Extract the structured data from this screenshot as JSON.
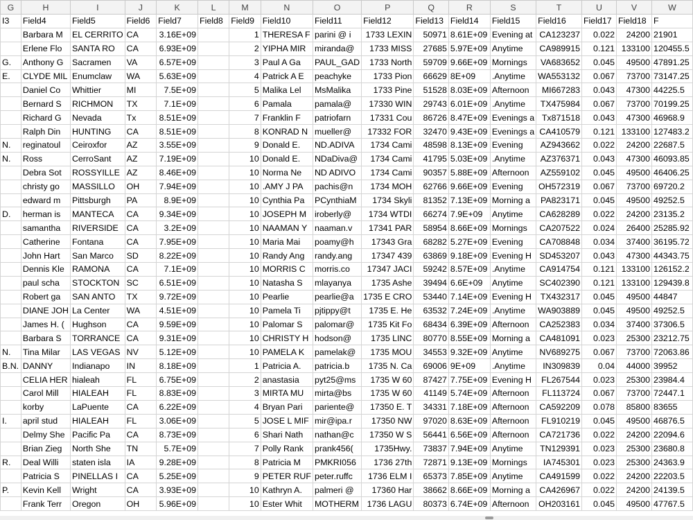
{
  "columns": [
    "G",
    "H",
    "I",
    "J",
    "K",
    "L",
    "M",
    "N",
    "O",
    "P",
    "Q",
    "R",
    "S",
    "T",
    "U",
    "V",
    "W"
  ],
  "rows": [
    [
      "I3",
      "Field4",
      "Field5",
      "Field6",
      "Field7",
      "Field8",
      "Field9",
      "Field10",
      "Field11",
      "Field12",
      "Field13",
      "Field14",
      "Field15",
      "Field16",
      "Field17",
      "Field18",
      "F"
    ],
    [
      "",
      "Barbara M",
      "EL CERRITO",
      "CA",
      "3.16E+09",
      "",
      "1",
      "THERESA F",
      "parini @ i",
      "1733 LEXIN",
      "50971",
      "8.61E+09",
      "Evening at",
      "CA123237",
      "0.022",
      "24200",
      "21901"
    ],
    [
      "",
      "Erlene Flo",
      "SANTA RO",
      "CA",
      "6.93E+09",
      "",
      "2",
      "YIPHA MIR",
      "miranda@",
      "1733 MISS",
      "27685",
      "5.97E+09",
      "Anytime",
      "CA989915",
      "0.121",
      "133100",
      "120455.5"
    ],
    [
      "G.",
      "Anthony G",
      "Sacramen",
      "VA",
      "6.57E+09",
      "",
      "3",
      "Paul A Ga",
      "PAUL_GAD",
      "1733 North",
      "59709",
      "9.66E+09",
      "Mornings",
      "VA683652",
      "0.045",
      "49500",
      "47891.25"
    ],
    [
      "E.",
      "CLYDE MIL",
      "Enumclaw",
      "WA",
      "5.63E+09",
      "",
      "4",
      "Patrick A E",
      "peachyke",
      "1733 Pion",
      "66629",
      "8E+09",
      ".Anytime",
      "WA553132",
      "0.067",
      "73700",
      "73147.25"
    ],
    [
      "",
      "Daniel Co",
      "Whittier",
      "MI",
      "7.5E+09",
      "",
      "5",
      "Malika Lel",
      "MsMalika",
      "1733 Pine",
      "51528",
      "8.03E+09",
      "Afternoon",
      "MI667283",
      "0.043",
      "47300",
      "44225.5"
    ],
    [
      "",
      "Bernard S",
      "RICHMON",
      "TX",
      "7.1E+09",
      "",
      "6",
      "Pamala",
      "pamala@",
      "17330 WIN",
      "29743",
      "6.01E+09",
      ".Anytime",
      "TX475984",
      "0.067",
      "73700",
      "70199.25"
    ],
    [
      "",
      "Richard G",
      "Nevada",
      "Tx",
      "8.51E+09",
      "",
      "7",
      "Franklin F",
      "patriofarn",
      "17331 Cou",
      "86726",
      "8.47E+09",
      "Evenings a",
      "Tx871518",
      "0.043",
      "47300",
      "46968.9"
    ],
    [
      "",
      "Ralph Din",
      "HUNTING",
      "CA",
      "8.51E+09",
      "",
      "8",
      "KONRAD N",
      "mueller@",
      "17332 FOR",
      "32470",
      "9.43E+09",
      "Evenings a",
      "CA410579",
      "0.121",
      "133100",
      "127483.2"
    ],
    [
      "N.",
      "reginatoul",
      "Ceiroxfor",
      "AZ",
      "3.55E+09",
      "",
      "9",
      "Donald E.",
      "ND.ADIVA",
      "1734 Cami",
      "48598",
      "8.13E+09",
      "Evening",
      "AZ943662",
      "0.022",
      "24200",
      "22687.5"
    ],
    [
      "N.",
      "Ross",
      "CerroSant",
      "AZ",
      "7.19E+09",
      "",
      "10",
      "Donald E.",
      "NDaDiva@",
      "1734 Cami",
      "41795",
      "5.03E+09",
      ".Anytime",
      "AZ376371",
      "0.043",
      "47300",
      "46093.85"
    ],
    [
      "",
      "Debra Sot",
      "ROSSYILLE",
      "AZ",
      "8.46E+09",
      "",
      "10",
      "Norma Ne",
      "ND ADIVO",
      "1734 Cami",
      "90357",
      "5.88E+09",
      "Afternoon",
      "AZ559102",
      "0.045",
      "49500",
      "46406.25"
    ],
    [
      "",
      "christy go",
      "MASSILLO",
      "OH",
      "7.94E+09",
      "",
      "10",
      ".AMY J PA",
      "pachis@n",
      "1734 MOH",
      "62766",
      "9.66E+09",
      "Evening",
      "OH572319",
      "0.067",
      "73700",
      "69720.2"
    ],
    [
      "",
      "edward m",
      "Pittsburgh",
      "PA",
      "8.9E+09",
      "",
      "10",
      "Cynthia Pa",
      "PCynthiaM",
      "1734 Skyli",
      "81352",
      "7.13E+09",
      "Morning a",
      "PA823171",
      "0.045",
      "49500",
      "49252.5"
    ],
    [
      "D.",
      "herman is",
      "MANTECA",
      "CA",
      "9.34E+09",
      "",
      "10",
      "JOSEPH M",
      "iroberly@",
      "1734 WTDI",
      "66274",
      "7.9E+09",
      "Anytime",
      "CA628289",
      "0.022",
      "24200",
      "23135.2"
    ],
    [
      "",
      "samantha",
      "RIVERSIDE",
      "CA",
      "3.2E+09",
      "",
      "10",
      "NAAMAN Y",
      "naaman.v",
      "17341 PAR",
      "58954",
      "8.66E+09",
      "Mornings",
      "CA207522",
      "0.024",
      "26400",
      "25285.92"
    ],
    [
      "",
      "Catherine",
      "Fontana",
      "CA",
      "7.95E+09",
      "",
      "10",
      "Maria Mai",
      "poamy@h",
      "17343 Gra",
      "68282",
      "5.27E+09",
      "Evening",
      "CA708848",
      "0.034",
      "37400",
      "36195.72"
    ],
    [
      "",
      "John Hart",
      "San Marco",
      "SD",
      "8.22E+09",
      "",
      "10",
      "Randy Ang",
      "randy.ang",
      "17347 439",
      "63869",
      "9.18E+09",
      "Evening H",
      "SD453207",
      "0.043",
      "47300",
      "44343.75"
    ],
    [
      "",
      "Dennis Kle",
      "RAMONA",
      "CA",
      "7.1E+09",
      "",
      "10",
      "MORRIS C",
      "morris.co",
      "17347 JACI",
      "59242",
      "8.57E+09",
      ".Anytime",
      "CA914754",
      "0.121",
      "133100",
      "126152.2"
    ],
    [
      "",
      "paul scha",
      "STOCKTON",
      "SC",
      "6.51E+09",
      "",
      "10",
      "Natasha S",
      "mlayanya",
      "1735 Ashe",
      "39494",
      "6.6E+09",
      "Anytime",
      "SC402390",
      "0.121",
      "133100",
      "129439.8"
    ],
    [
      "",
      "Robert ga",
      "SAN ANTO",
      "TX",
      "9.72E+09",
      "",
      "10",
      "Pearlie",
      "pearlie@a",
      "1735 E CRO",
      "53440",
      "7.14E+09",
      "Evening H",
      "TX432317",
      "0.045",
      "49500",
      "44847"
    ],
    [
      "",
      "DIANE JOH",
      "La Center",
      "WA",
      "4.51E+09",
      "",
      "10",
      "Pamela Ti",
      "pjtippy@t",
      "1735 E. He",
      "63532",
      "7.24E+09",
      ".Anytime",
      "WA903889",
      "0.045",
      "49500",
      "49252.5"
    ],
    [
      "",
      "James H. (",
      "Hughson",
      "CA",
      "9.59E+09",
      "",
      "10",
      "Palomar S",
      "palomar@",
      "1735 Kit Fo",
      "68434",
      "6.39E+09",
      "Afternoon",
      "CA252383",
      "0.034",
      "37400",
      "37306.5"
    ],
    [
      "",
      "Barbara S",
      "TORRANCE",
      "CA",
      "9.31E+09",
      "",
      "10",
      "CHRISTY H",
      "hodson@",
      "1735 LINC",
      "80770",
      "8.55E+09",
      "Morning a",
      "CA481091",
      "0.023",
      "25300",
      "23212.75"
    ],
    [
      "N.",
      "Tina Milar",
      "LAS VEGAS",
      "NV",
      "5.12E+09",
      "",
      "10",
      "PAMELA K",
      "pamelak@",
      "1735 MOU",
      "34553",
      "9.32E+09",
      "Anytime",
      "NV689275",
      "0.067",
      "73700",
      "72063.86"
    ],
    [
      "B.N.",
      "DANNY",
      "Indianapo",
      "IN",
      "8.18E+09",
      "",
      "1",
      "Patricia A.",
      "patricia.b",
      "1735 N. Ca",
      "69006",
      "9E+09",
      ".Anytime",
      "IN309839",
      "0.04",
      "44000",
      "39952"
    ],
    [
      "",
      "CELIA HER",
      "hialeah",
      "FL",
      "6.75E+09",
      "",
      "2",
      "anastasia",
      "pyt25@ms",
      "1735 W 60",
      "87427",
      "7.75E+09",
      "Evening H",
      "FL267544",
      "0.023",
      "25300",
      "23984.4"
    ],
    [
      "",
      "Carol Mill",
      "HIALEAH",
      "FL",
      "8.83E+09",
      "",
      "3",
      "MIRTA MU",
      "mirta@bs",
      "1735 W 60",
      "41149",
      "5.74E+09",
      "Afternoon",
      "FL113724",
      "0.067",
      "73700",
      "72447.1"
    ],
    [
      "",
      "korby",
      "LaPuente",
      "CA",
      "6.22E+09",
      "",
      "4",
      "Bryan Pari",
      "pariente@",
      "17350 E. T",
      "34331",
      "7.18E+09",
      "Afternoon",
      "CA592209",
      "0.078",
      "85800",
      "83655"
    ],
    [
      "I.",
      "april stud",
      "HIALEAH",
      "FL",
      "3.06E+09",
      "",
      "5",
      "JOSE L MIF",
      "mir@ipa.r",
      "17350 NW",
      "97020",
      "8.63E+09",
      "Afternoon",
      "FL910219",
      "0.045",
      "49500",
      "46876.5"
    ],
    [
      "",
      "Delmy She",
      "Pacific Pa",
      "CA",
      "8.73E+09",
      "",
      "6",
      "Shari Nath",
      "nathan@c",
      "17350 W S",
      "56441",
      "6.56E+09",
      "Afternoon",
      "CA721736",
      "0.022",
      "24200",
      "22094.6"
    ],
    [
      "",
      "Brian Zieg",
      "North She",
      "TN",
      "5.7E+09",
      "",
      "7",
      "Polly Rank",
      "prank456(",
      "1735Hwy. ",
      "73837",
      "7.94E+09",
      "Anytime",
      "TN129391",
      "0.023",
      "25300",
      "23680.8"
    ],
    [
      "R.",
      "Deal Willi",
      "staten isla",
      "IA",
      "9.28E+09",
      "",
      "8",
      "Patricia M",
      "PMKRI056",
      "1736 27th",
      "72871",
      "9.13E+09",
      "Mornings",
      "IA745301",
      "0.023",
      "25300",
      "24363.9"
    ],
    [
      "",
      "Patricia S",
      "PINELLAS I",
      "CA",
      "5.25E+09",
      "",
      "9",
      "PETER RUF",
      "peter.ruffc",
      "1736 ELM I",
      "65373",
      "7.85E+09",
      "Anytime",
      "CA491599",
      "0.022",
      "24200",
      "22203.5"
    ],
    [
      "P.",
      "Kevin Kell",
      "Wright",
      "CA",
      "3.93E+09",
      "",
      "10",
      "Kathryn A.",
      "palmeri @",
      "17360 Har",
      "38662",
      "8.66E+09",
      "Morning a",
      "CA426967",
      "0.022",
      "24200",
      "24139.5"
    ],
    [
      "",
      "Frank Terr",
      "Oregon",
      "OH",
      "5.96E+09",
      "",
      "10",
      "Ester Whit",
      "MOTHERM",
      "1736 LAGU",
      "80373",
      "6.74E+09",
      "Afternoon",
      "OH203161",
      "0.045",
      "49500",
      "47767.5"
    ]
  ]
}
